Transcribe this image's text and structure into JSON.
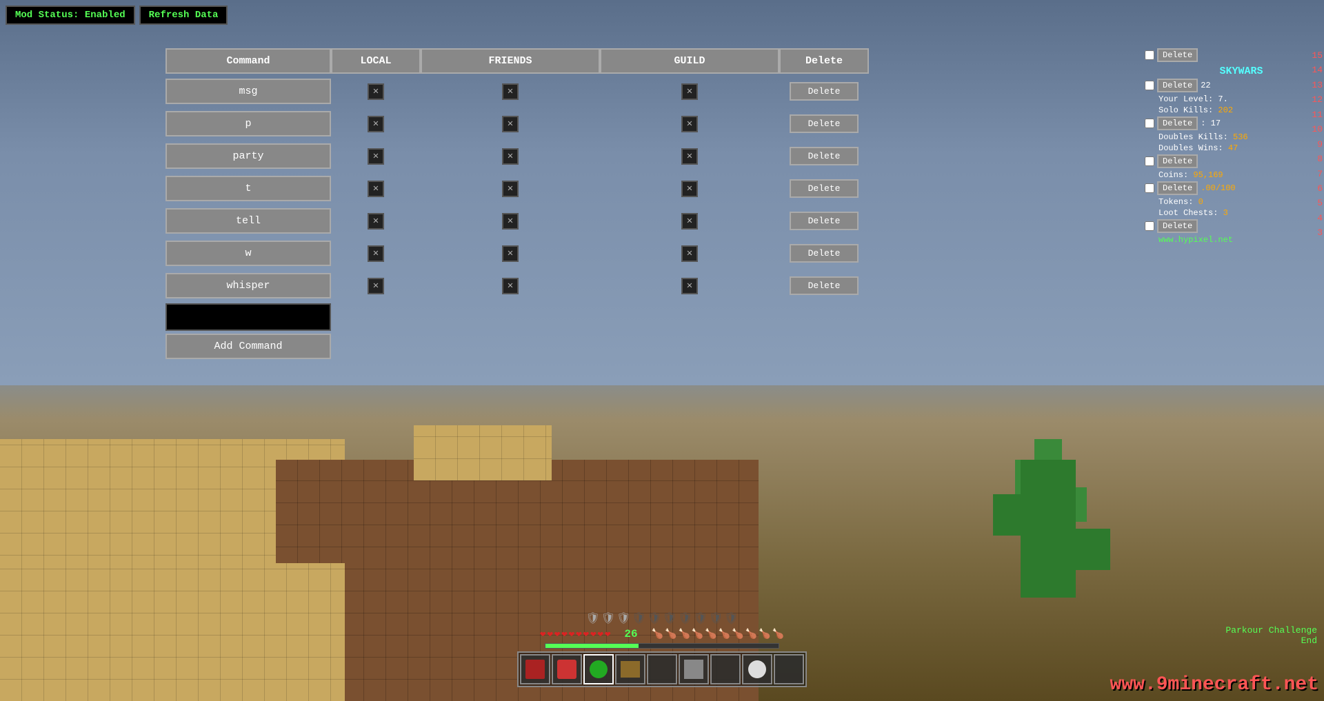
{
  "topbar": {
    "mod_status": "Mod Status: Enabled",
    "refresh": "Refresh Data"
  },
  "panel": {
    "headers": {
      "command": "Command",
      "local": "LOCAL",
      "friends": "FRIENDS",
      "guild": "GUILD",
      "delete": "Delete"
    },
    "commands": [
      {
        "name": "msg",
        "local": true,
        "friends": true,
        "guild": true
      },
      {
        "name": "p",
        "local": true,
        "friends": true,
        "guild": true
      },
      {
        "name": "party",
        "local": true,
        "friends": true,
        "guild": true
      },
      {
        "name": "t",
        "local": true,
        "friends": true,
        "guild": true
      },
      {
        "name": "tell",
        "local": true,
        "friends": true,
        "guild": true
      },
      {
        "name": "w",
        "local": true,
        "friends": true,
        "guild": true
      },
      {
        "name": "whisper",
        "local": true,
        "friends": true,
        "guild": true
      }
    ],
    "add_command": "Add Command",
    "input_placeholder": ""
  },
  "right_panel": {
    "delete_label": "Delete",
    "skywars": "SKYWARS",
    "rows": [
      {
        "type": "delete",
        "label": "Delete"
      },
      {
        "type": "skywars"
      },
      {
        "type": "score_line",
        "label": "",
        "val": "22",
        "val_color": "orange"
      },
      {
        "type": "score_line",
        "label": "Your Level: 7",
        "val": "",
        "val_color": "white"
      },
      {
        "type": "score_line",
        "label": "Solo Kills:",
        "val": "202",
        "val_color": "orange"
      },
      {
        "type": "delete",
        "label": "Delete"
      },
      {
        "type": "score_line",
        "label": "Doubles Kills:",
        "val": "536",
        "val_color": "orange"
      },
      {
        "type": "score_line",
        "label": "Doubles Wins:",
        "val": "47",
        "val_color": "orange"
      },
      {
        "type": "delete",
        "label": "Delete"
      },
      {
        "type": "score_line",
        "label": "Coins:",
        "val": "95,169",
        "val_color": "orange"
      },
      {
        "type": "delete",
        "label": "Delete"
      },
      {
        "type": "score_line",
        "label": "Tokens:",
        "val": "0",
        "val_color": "orange"
      },
      {
        "type": "score_line",
        "label": "Loot Chests:",
        "val": "3",
        "val_color": "orange"
      },
      {
        "type": "delete",
        "label": "Delete"
      },
      {
        "type": "score_line",
        "label": "www.hypixel.net",
        "val": "",
        "val_color": "green"
      }
    ]
  },
  "edge_numbers": [
    "15",
    "14",
    "13",
    "12",
    "11",
    "10",
    "9",
    "8",
    "7",
    "6",
    "5",
    "4",
    "3"
  ],
  "hud": {
    "level": "26",
    "xp_percent": 40
  },
  "parkour": {
    "line1": "Parkour Challenge",
    "line2": "End"
  },
  "watermark": "www.9minecraft.net"
}
